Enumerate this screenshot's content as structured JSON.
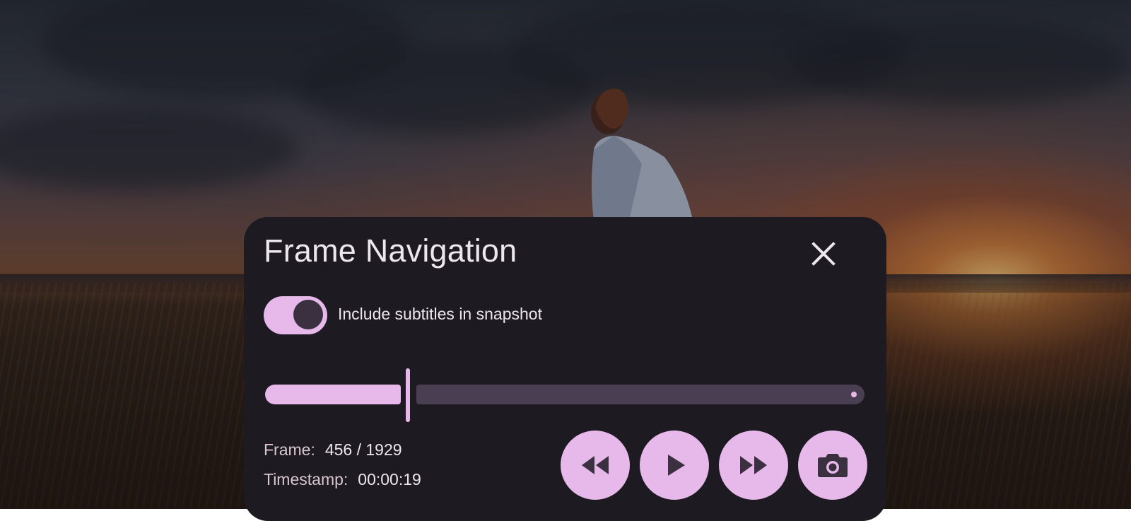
{
  "dialog": {
    "title": "Frame Navigation",
    "close_icon": "close-icon"
  },
  "subtitle_toggle": {
    "label": "Include subtitles in snapshot",
    "checked": true
  },
  "frame_slider": {
    "progress_fraction": 0.236
  },
  "frame_info": {
    "frame_label": "Frame:",
    "frame_value": "456 / 1929",
    "timestamp_label": "Timestamp:",
    "timestamp_value": "00:00:19"
  },
  "controls": [
    {
      "name": "rewind-button",
      "icon": "rewind-icon"
    },
    {
      "name": "play-button",
      "icon": "play-icon"
    },
    {
      "name": "fast-forward-button",
      "icon": "fast-forward-icon"
    },
    {
      "name": "snapshot-button",
      "icon": "camera-icon"
    }
  ],
  "colors": {
    "accent": "#e7b8ea",
    "panel_bg": "#1d1a21",
    "track_inactive": "#4a3f52",
    "icon_dark": "#3a3040"
  }
}
